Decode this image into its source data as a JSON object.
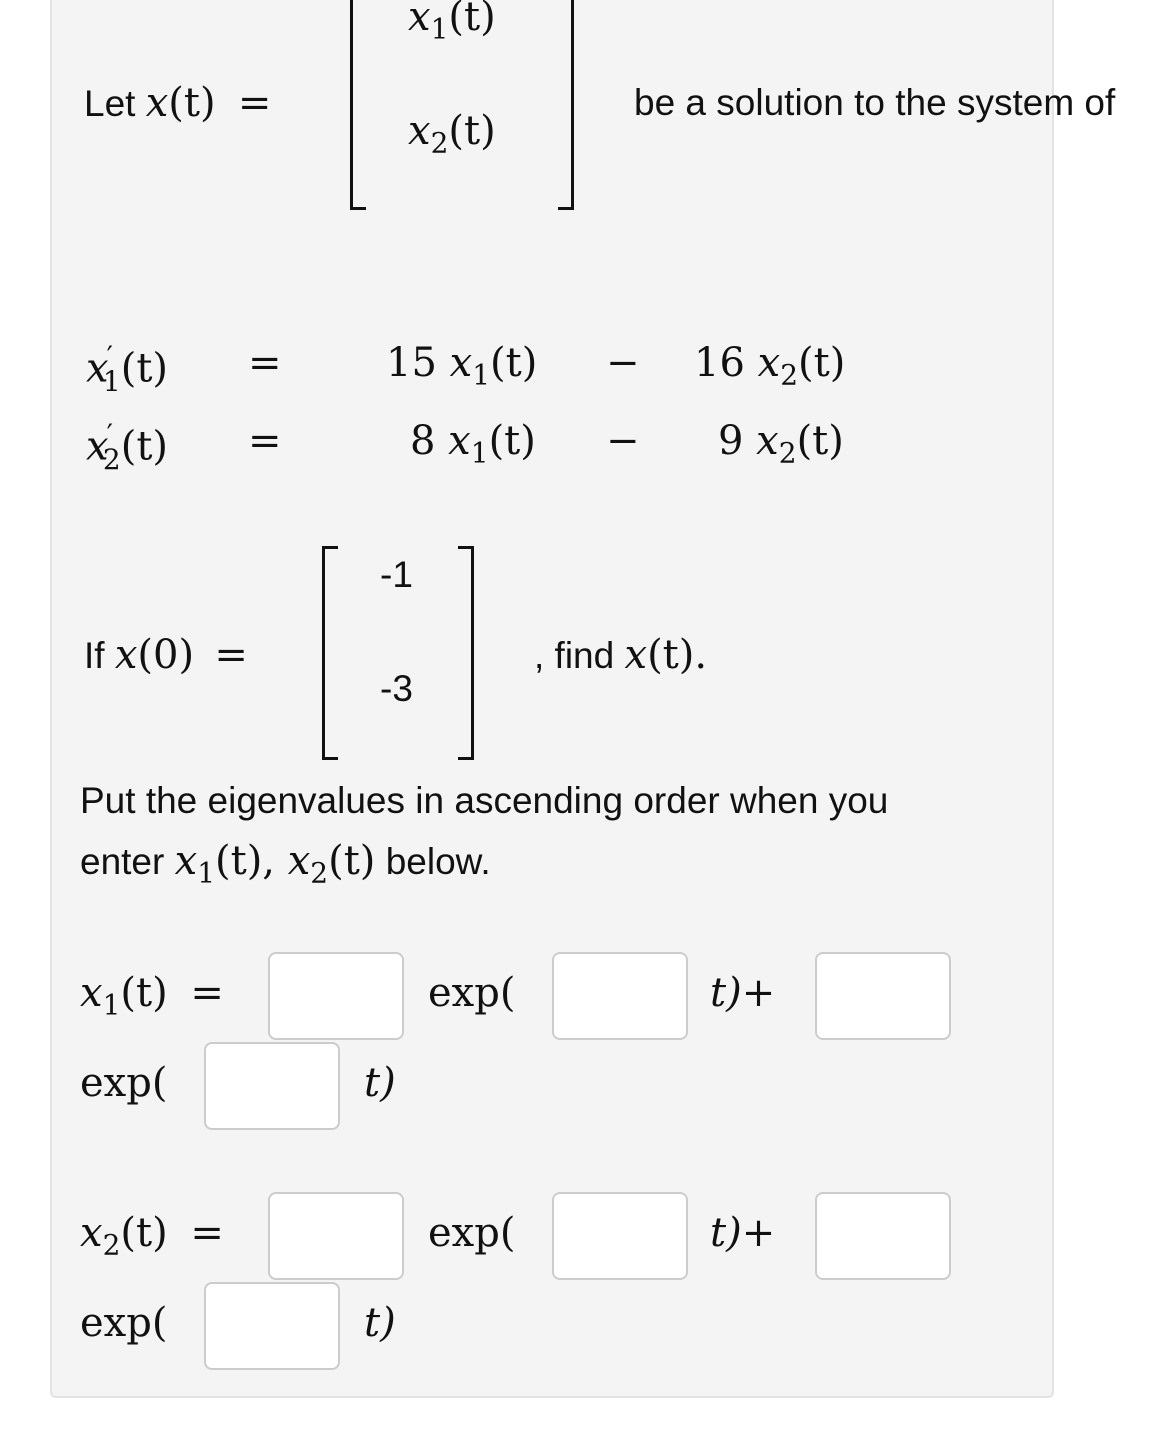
{
  "intro": {
    "prefix": "Let",
    "var": "x",
    "arg": "(t)",
    "equals": "=",
    "vector": [
      {
        "var": "x",
        "sub": "1",
        "arg": "(t)"
      },
      {
        "var": "x",
        "sub": "2",
        "arg": "(t)"
      }
    ],
    "suffix": "be a solution to the system of"
  },
  "system": {
    "rows": [
      {
        "lhs_var": "x",
        "lhs_sub": "1",
        "lhs_prime": "′",
        "lhs_arg": "(t)",
        "eq": "=",
        "c1": "15",
        "t1_var": "x",
        "t1_sub": "1",
        "t1_arg": "(t)",
        "op": "−",
        "c2": "16",
        "t2_var": "x",
        "t2_sub": "2",
        "t2_arg": "(t)"
      },
      {
        "lhs_var": "x",
        "lhs_sub": "2",
        "lhs_prime": "′",
        "lhs_arg": "(t)",
        "eq": "=",
        "c1": "8",
        "t1_var": "x",
        "t1_sub": "1",
        "t1_arg": "(t)",
        "op": "−",
        "c2": "9",
        "t2_var": "x",
        "t2_sub": "2",
        "t2_arg": "(t)"
      }
    ]
  },
  "initial": {
    "prefix": "If",
    "var": "x",
    "arg": "(0)",
    "equals": "=",
    "values": [
      "-1",
      "-3"
    ],
    "suffix_comma": ", find",
    "suffix_var": "x",
    "suffix_arg": "(t)."
  },
  "instructions": {
    "line1": "Put the eigenvalues in ascending order when you",
    "line2_prefix": "enter",
    "line2_math": [
      {
        "var": "x",
        "sub": "1",
        "arg": "(t),"
      },
      {
        "var": "x",
        "sub": "2",
        "arg": "(t)"
      }
    ],
    "line2_suffix": "below."
  },
  "answers": [
    {
      "lhs_var": "x",
      "lhs_sub": "1",
      "lhs_arg": "(t)",
      "eq": "=",
      "exp_label": "exp(",
      "t_close": "t)",
      "plus": "+",
      "fields": {
        "coef1": "",
        "rate1": "",
        "coef2": "",
        "rate2": ""
      }
    },
    {
      "lhs_var": "x",
      "lhs_sub": "2",
      "lhs_arg": "(t)",
      "eq": "=",
      "exp_label": "exp(",
      "t_close": "t)",
      "plus": "+",
      "fields": {
        "coef1": "",
        "rate1": "",
        "coef2": "",
        "rate2": ""
      }
    }
  ]
}
